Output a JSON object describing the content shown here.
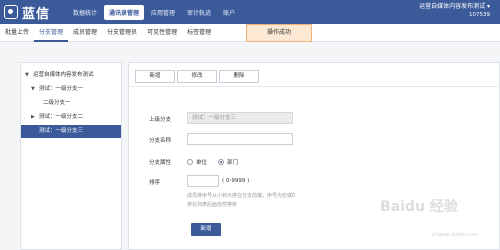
{
  "brand": {
    "name": "蓝信"
  },
  "nav": {
    "items": [
      "数据统计",
      "通讯录管理",
      "应用管理",
      "审计轨迹",
      "账户"
    ],
    "active_index": 1
  },
  "corp": {
    "name": "运营自媒体内容发布测试 ▾",
    "id": "107539"
  },
  "subnav": {
    "items": [
      "批量上传",
      "分支管理",
      "成员管理",
      "分支管理员",
      "可见性管理",
      "标签管理"
    ],
    "active_index": 1
  },
  "toast": {
    "text": "操作成功"
  },
  "tree": {
    "items": [
      {
        "label": "运营自媒体内容发布测试",
        "caret": "▼",
        "depth": 0
      },
      {
        "label": "测试：一级分支一",
        "caret": "▼",
        "depth": 1
      },
      {
        "label": "二级分支一",
        "caret": "",
        "depth": 2
      },
      {
        "label": "测试：一级分支二",
        "caret": "▶",
        "depth": 1
      },
      {
        "label": "测试：一级分支三",
        "caret": "",
        "depth": 1,
        "selected": true
      }
    ]
  },
  "toolbar": {
    "add_label": "新增",
    "edit_label": "修改",
    "delete_label": "删除"
  },
  "form": {
    "parent_label": "上级分支",
    "parent_value": "测试：一级分支三",
    "name_label": "分支名称",
    "name_value": "",
    "attr_label": "分支属性",
    "attr_options": [
      "单位",
      "部门"
    ],
    "attr_selected": 1,
    "order_label": "排序",
    "order_value": "",
    "order_range": "( 0-9999 )",
    "hint_line1": "成员排序号从小到大排在分支前端，序号为空或0",
    "hint_line2": "排在列表后面自然排序",
    "submit_label": "新增"
  },
  "colors": {
    "brand": "#3b5a9a",
    "toast_bg": "#fde9d3",
    "toast_border": "#f1b27a"
  }
}
